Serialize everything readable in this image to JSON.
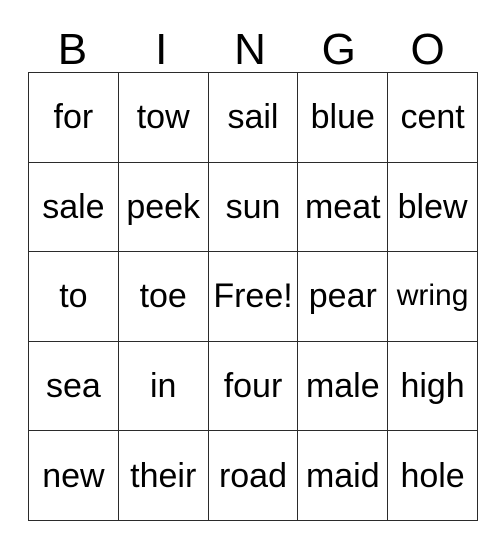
{
  "card": {
    "title": "BINGO",
    "headers": [
      "B",
      "I",
      "N",
      "G",
      "O"
    ],
    "free_space_label": "Free!",
    "colors": {
      "background": "#ffffff",
      "text": "#000000",
      "grid_line": "#2b2b2b"
    },
    "rows": [
      {
        "cells": [
          {
            "text": "for",
            "column": "B"
          },
          {
            "text": "tow",
            "column": "I"
          },
          {
            "text": "sail",
            "column": "N"
          },
          {
            "text": "blue",
            "column": "G"
          },
          {
            "text": "cent",
            "column": "O"
          }
        ]
      },
      {
        "cells": [
          {
            "text": "sale",
            "column": "B"
          },
          {
            "text": "peek",
            "column": "I"
          },
          {
            "text": "sun",
            "column": "N"
          },
          {
            "text": "meat",
            "column": "G"
          },
          {
            "text": "blew",
            "column": "O"
          }
        ]
      },
      {
        "cells": [
          {
            "text": "to",
            "column": "B"
          },
          {
            "text": "toe",
            "column": "I"
          },
          {
            "text": "Free!",
            "column": "N"
          },
          {
            "text": "pear",
            "column": "G"
          },
          {
            "text": "wring",
            "column": "O"
          }
        ]
      },
      {
        "cells": [
          {
            "text": "sea",
            "column": "B"
          },
          {
            "text": "in",
            "column": "I"
          },
          {
            "text": "four",
            "column": "N"
          },
          {
            "text": "male",
            "column": "G"
          },
          {
            "text": "high",
            "column": "O"
          }
        ]
      },
      {
        "cells": [
          {
            "text": "new",
            "column": "B"
          },
          {
            "text": "their",
            "column": "I"
          },
          {
            "text": "road",
            "column": "N"
          },
          {
            "text": "maid",
            "column": "G"
          },
          {
            "text": "hole",
            "column": "O"
          }
        ]
      }
    ]
  }
}
